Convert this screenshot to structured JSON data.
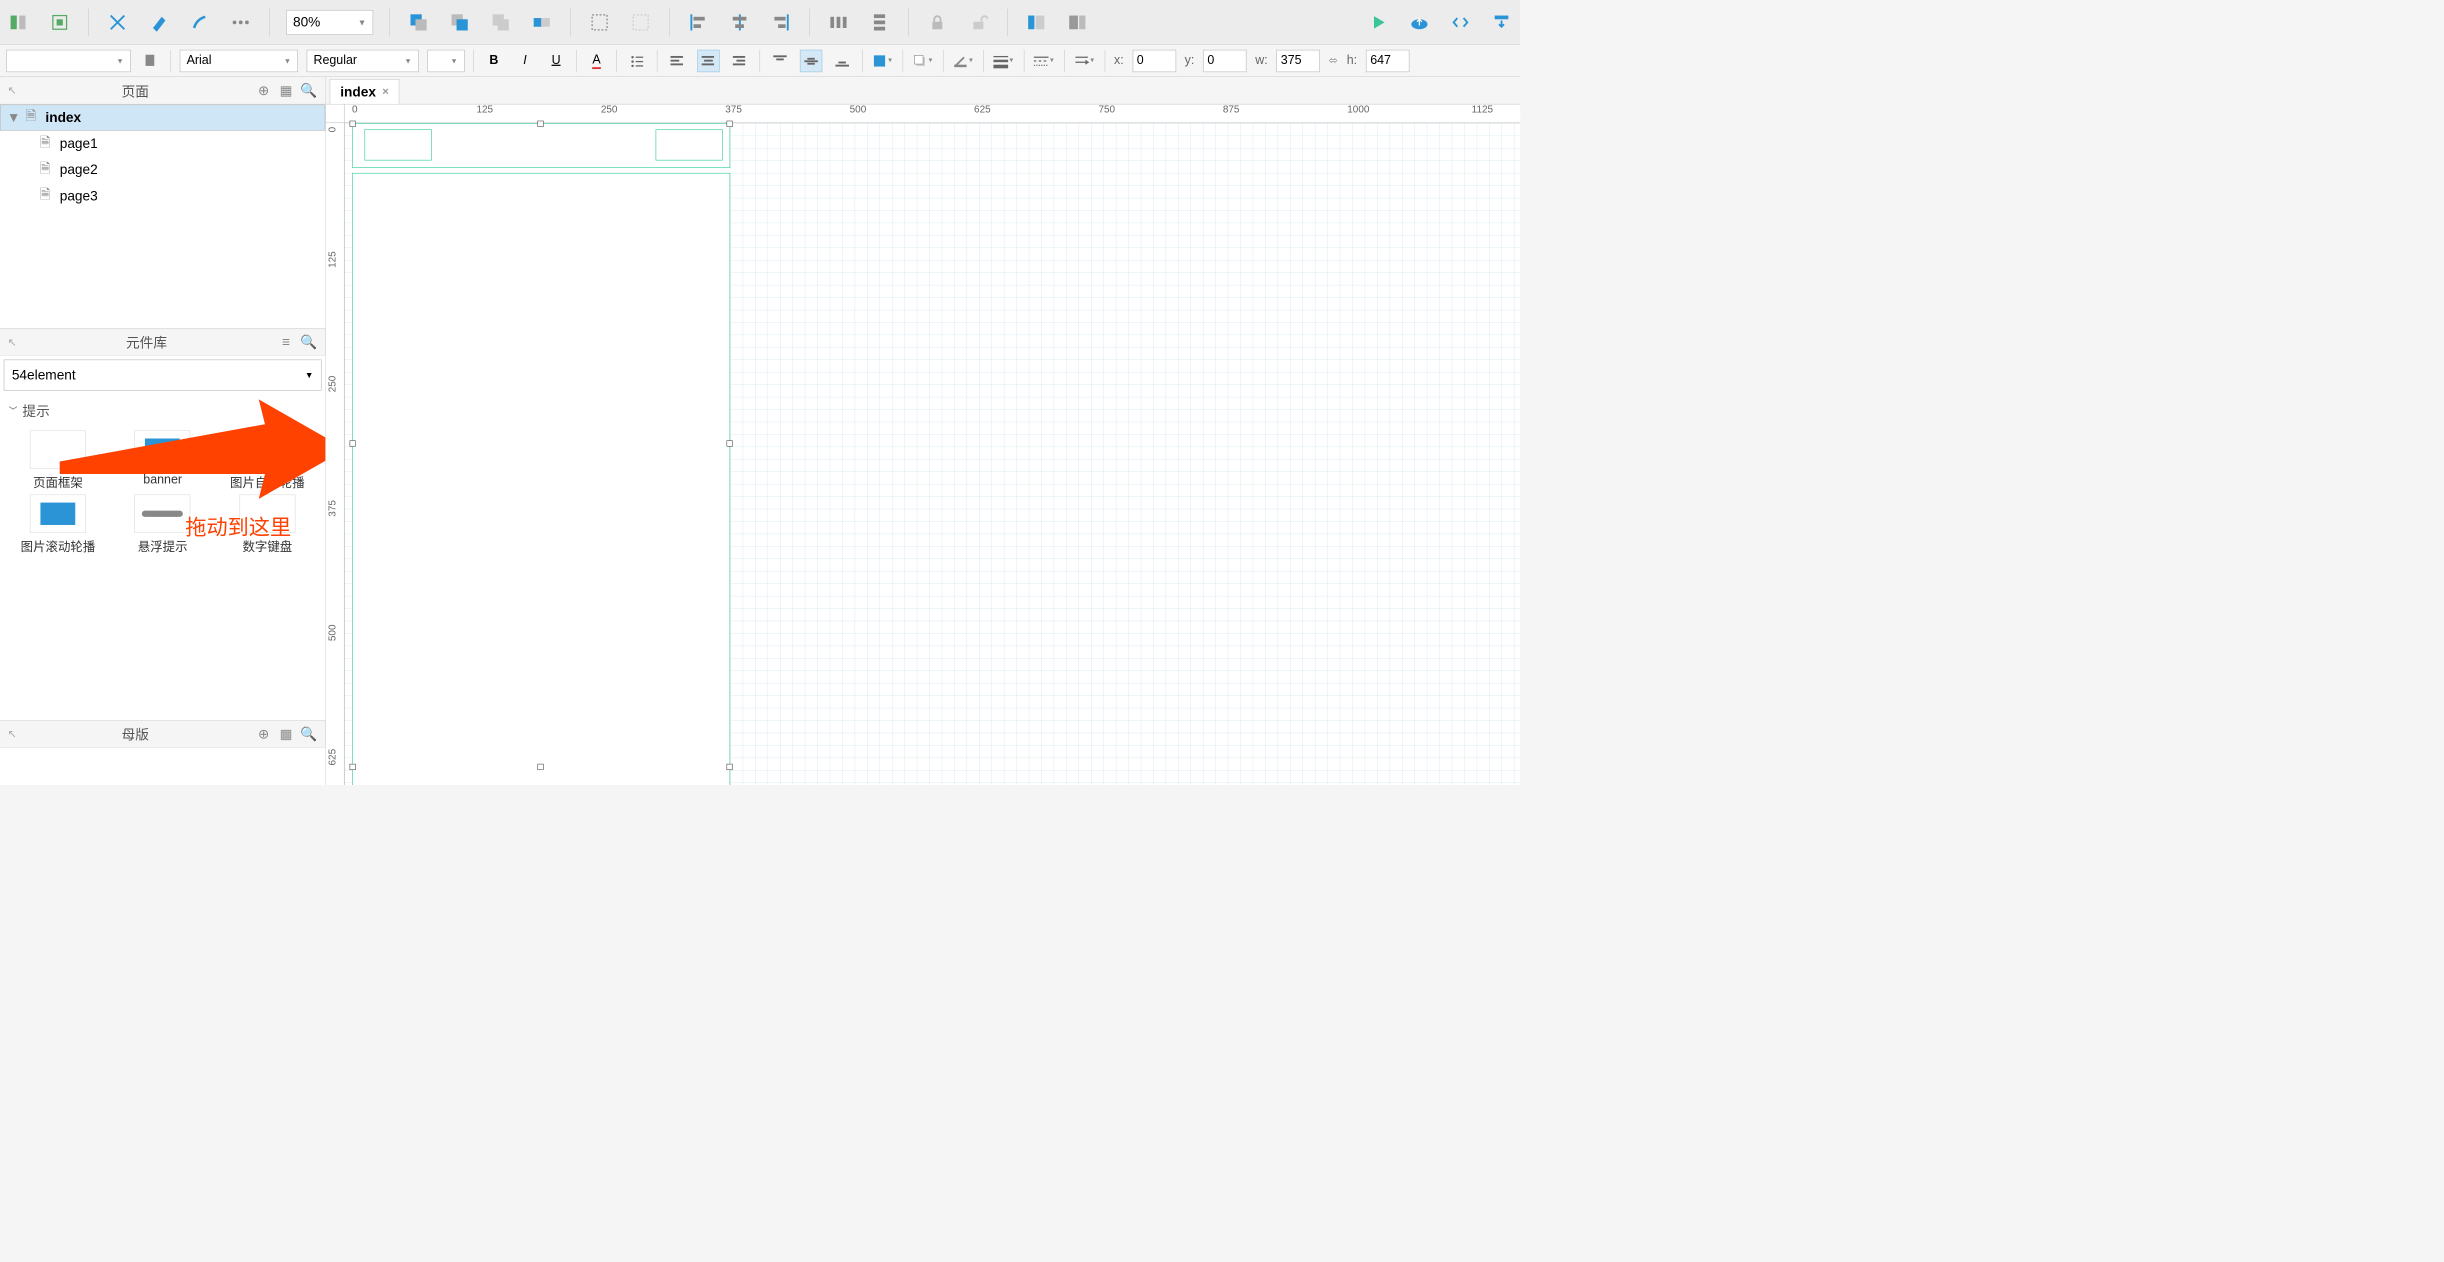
{
  "toolbar1": {
    "zoom": "80%"
  },
  "toolbar2": {
    "font": "Arial",
    "weight": "Regular",
    "x_lbl": "x:",
    "x": "0",
    "y_lbl": "y:",
    "y": "0",
    "w_lbl": "w:",
    "w": "375",
    "h_lbl": "h:",
    "h": "647"
  },
  "panels": {
    "pages": "页面",
    "library": "元件库",
    "masters": "母版"
  },
  "pages": {
    "root": "index",
    "children": [
      "page1",
      "page2",
      "page3"
    ]
  },
  "library": {
    "selected": "54element",
    "category": "提示",
    "widgets": [
      "页面框架",
      "banner",
      "图片自动轮播",
      "图片滚动轮播",
      "悬浮提示",
      "数字键盘"
    ]
  },
  "tab": {
    "name": "index"
  },
  "ruler": {
    "h": [
      "0",
      "125",
      "250",
      "375",
      "500",
      "625",
      "750",
      "875",
      "1000",
      "1125"
    ],
    "v": [
      "0",
      "125",
      "250",
      "375",
      "500",
      "625"
    ]
  },
  "annotation": "拖动到这里"
}
